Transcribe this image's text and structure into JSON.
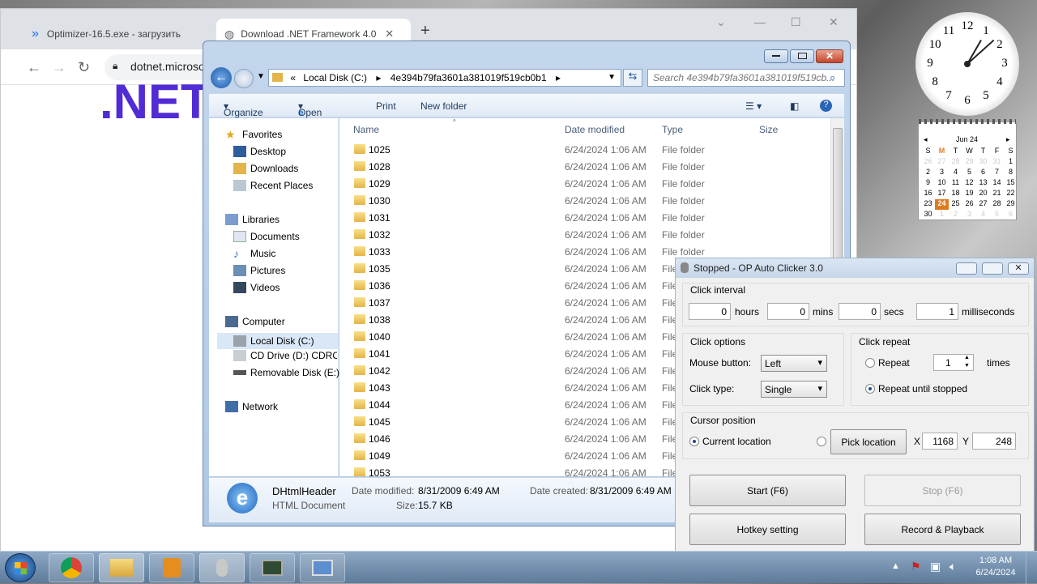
{
  "browser": {
    "tabs": [
      {
        "title": "Optimizer-16.5.exe - загрузить …"
      },
      {
        "title": "Download .NET Framework 4.0 …"
      }
    ],
    "new_tab": "+",
    "address": "dotnet.microso",
    "page_logo": ".NET"
  },
  "explorer": {
    "address": [
      "Local Disk (C:)",
      "4e394b79fa3601a381019f519cb0b1"
    ],
    "search_placeholder": "Search 4e394b79fa3601a381019f519cb...",
    "toolbar": {
      "organize": "Organize",
      "open": "Open",
      "print": "Print",
      "new_folder": "New folder"
    },
    "nav": {
      "favorites": "Favorites",
      "fav_items": [
        "Desktop",
        "Downloads",
        "Recent Places"
      ],
      "libraries": "Libraries",
      "lib_items": [
        "Documents",
        "Music",
        "Pictures",
        "Videos"
      ],
      "computer": "Computer",
      "comp_items": [
        "Local Disk (C:)",
        "CD Drive (D:) CDROM",
        "Removable Disk (E:)"
      ],
      "network": "Network"
    },
    "columns": {
      "name": "Name",
      "date": "Date modified",
      "type": "Type",
      "size": "Size"
    },
    "files": [
      {
        "name": "1025",
        "date": "6/24/2024 1:06 AM",
        "type": "File folder"
      },
      {
        "name": "1028",
        "date": "6/24/2024 1:06 AM",
        "type": "File folder"
      },
      {
        "name": "1029",
        "date": "6/24/2024 1:06 AM",
        "type": "File folder"
      },
      {
        "name": "1030",
        "date": "6/24/2024 1:06 AM",
        "type": "File folder"
      },
      {
        "name": "1031",
        "date": "6/24/2024 1:06 AM",
        "type": "File folder"
      },
      {
        "name": "1032",
        "date": "6/24/2024 1:06 AM",
        "type": "File folder"
      },
      {
        "name": "1033",
        "date": "6/24/2024 1:06 AM",
        "type": "File folder"
      },
      {
        "name": "1035",
        "date": "6/24/2024 1:06 AM",
        "type": "File"
      },
      {
        "name": "1036",
        "date": "6/24/2024 1:06 AM",
        "type": "File"
      },
      {
        "name": "1037",
        "date": "6/24/2024 1:06 AM",
        "type": "File"
      },
      {
        "name": "1038",
        "date": "6/24/2024 1:06 AM",
        "type": "File"
      },
      {
        "name": "1040",
        "date": "6/24/2024 1:06 AM",
        "type": "File"
      },
      {
        "name": "1041",
        "date": "6/24/2024 1:06 AM",
        "type": "File"
      },
      {
        "name": "1042",
        "date": "6/24/2024 1:06 AM",
        "type": "File"
      },
      {
        "name": "1043",
        "date": "6/24/2024 1:06 AM",
        "type": "File"
      },
      {
        "name": "1044",
        "date": "6/24/2024 1:06 AM",
        "type": "File"
      },
      {
        "name": "1045",
        "date": "6/24/2024 1:06 AM",
        "type": "File"
      },
      {
        "name": "1046",
        "date": "6/24/2024 1:06 AM",
        "type": "File"
      },
      {
        "name": "1049",
        "date": "6/24/2024 1:06 AM",
        "type": "File"
      },
      {
        "name": "1053",
        "date": "6/24/2024 1:06 AM",
        "type": "File"
      }
    ],
    "details": {
      "name": "DHtmlHeader",
      "kind": "HTML Document",
      "modified_label": "Date modified:",
      "modified": "8/31/2009 6:49 AM",
      "created_label": "Date created:",
      "created": "8/31/2009 6:49 AM",
      "size_label": "Size:",
      "size": "15.7 KB"
    }
  },
  "clicker": {
    "title": "Stopped - OP Auto Clicker 3.0",
    "interval_label": "Click interval",
    "hours": "0",
    "hours_label": "hours",
    "mins": "0",
    "mins_label": "mins",
    "secs": "0",
    "secs_label": "secs",
    "ms": "1",
    "ms_label": "milliseconds",
    "options_label": "Click options",
    "mouse_button_label": "Mouse button:",
    "mouse_button": "Left",
    "click_type_label": "Click type:",
    "click_type": "Single",
    "repeat_label": "Click repeat",
    "repeat": "Repeat",
    "repeat_times": "1",
    "times_label": "times",
    "repeat_until": "Repeat until stopped",
    "cursor_label": "Cursor position",
    "current_location": "Current location",
    "pick_location": "Pick location",
    "x_label": "X",
    "x": "1168",
    "y_label": "Y",
    "y": "248",
    "start": "Start (F6)",
    "stop": "Stop (F6)",
    "hotkey": "Hotkey setting",
    "record": "Record & Playback"
  },
  "calendar": {
    "month": "Jun 24",
    "weekdays": [
      "S",
      "M",
      "T",
      "W",
      "T",
      "F",
      "S"
    ],
    "days": [
      "26",
      "27",
      "28",
      "29",
      "30",
      "31",
      "1",
      "2",
      "3",
      "4",
      "5",
      "6",
      "7",
      "8",
      "9",
      "10",
      "11",
      "12",
      "13",
      "14",
      "15",
      "16",
      "17",
      "18",
      "19",
      "20",
      "21",
      "22",
      "23",
      "24",
      "25",
      "26",
      "27",
      "28",
      "29",
      "30",
      "1",
      "2",
      "3",
      "4",
      "5",
      "6"
    ],
    "today": "24"
  },
  "clock_numbers": [
    "12",
    "1",
    "2",
    "3",
    "4",
    "5",
    "6",
    "7",
    "8",
    "9",
    "10",
    "11"
  ],
  "taskbar": {
    "time": "1:08 AM",
    "date": "6/24/2024"
  }
}
